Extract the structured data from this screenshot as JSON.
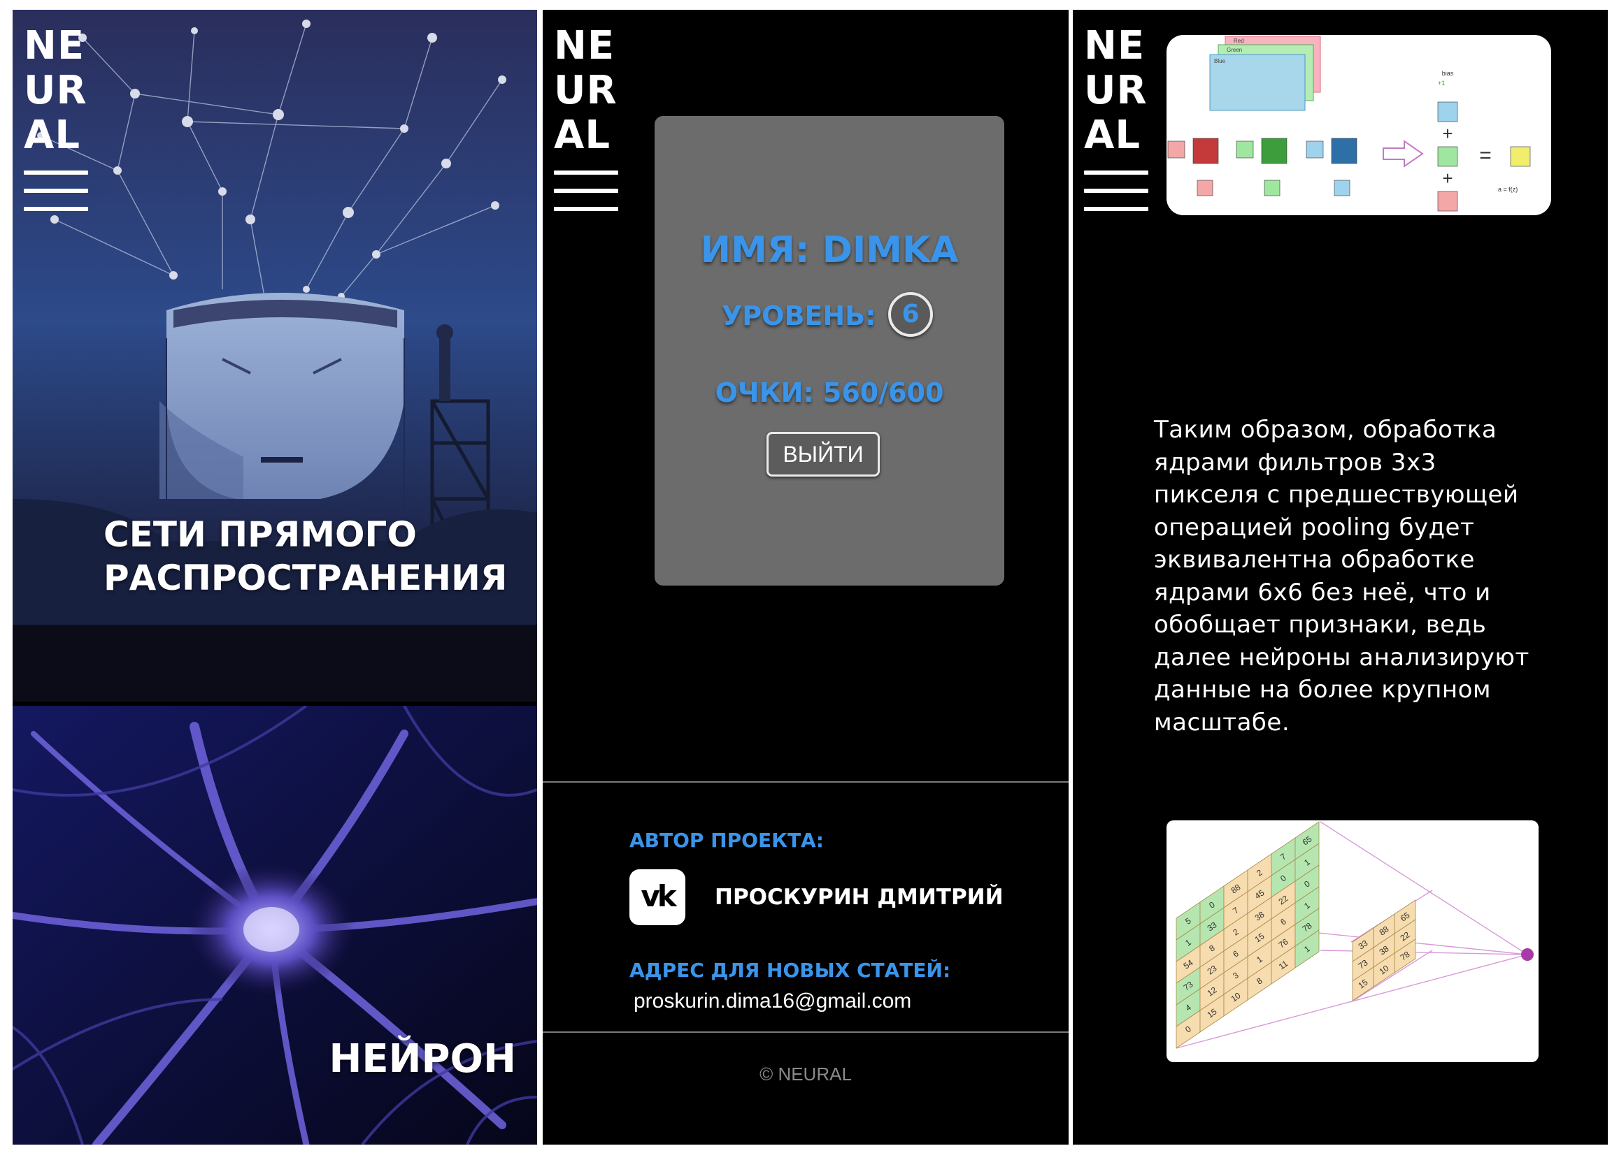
{
  "logo": {
    "line1": "NE",
    "line2": "UR",
    "line3": "AL"
  },
  "panel1": {
    "card1_title": "СЕТИ ПРЯМОГО РАСПРОСТРАНЕНИЯ",
    "card2_title": "НЕЙРОН"
  },
  "profile": {
    "name": "ИМЯ: DIMKA",
    "level_label": "УРОВЕНЬ:",
    "level_value": "6",
    "score": "ОЧКИ: 560/600",
    "logout_label": "ВЫЙТИ"
  },
  "footer": {
    "author_label": "АВТОР ПРОЕКТА:",
    "vk_icon": "vk-icon",
    "author_name": "ПРОСКУРИН ДМИТРИЙ",
    "address_label": "АДРЕС ДЛЯ НОВЫХ СТАТЕЙ:",
    "email": "proskurin.dima16@gmail.com",
    "copyright": "© NEURAL"
  },
  "article": {
    "text": "Таким образом, обработка ядрами фильтров 3х3 пикселя с предшествующей операцией pooling будет эквивалентна обработке ядрами 6х6 без неё, что и обобщает признаки, ведь далее нейроны анализируют данные на более крупном масштабе.",
    "fig_top_labels": {
      "red": "Red",
      "green": "Green",
      "blue": "Blue",
      "bias": "bias",
      "plus_one": "+1",
      "formula": "a = f(z)"
    },
    "grid_big": [
      [
        "5",
        "0",
        "88",
        "2",
        "7",
        "65"
      ],
      [
        "1",
        "33",
        "7",
        "45",
        "0",
        "1"
      ],
      [
        "54",
        "8",
        "2",
        "38",
        "22",
        "0"
      ],
      [
        "73",
        "23",
        "6",
        "15",
        "6",
        "1"
      ],
      [
        "4",
        "12",
        "3",
        "1",
        "76",
        "78"
      ],
      [
        "0",
        "15",
        "10",
        "8",
        "11",
        "1"
      ]
    ],
    "grid_small": [
      [
        "33",
        "88",
        "65"
      ],
      [
        "73",
        "38",
        "22"
      ],
      [
        "15",
        "10",
        "78"
      ]
    ]
  },
  "colors": {
    "accent": "#3a95ea",
    "panel_bg": "#000000",
    "card_bg": "#6c6c6c"
  }
}
